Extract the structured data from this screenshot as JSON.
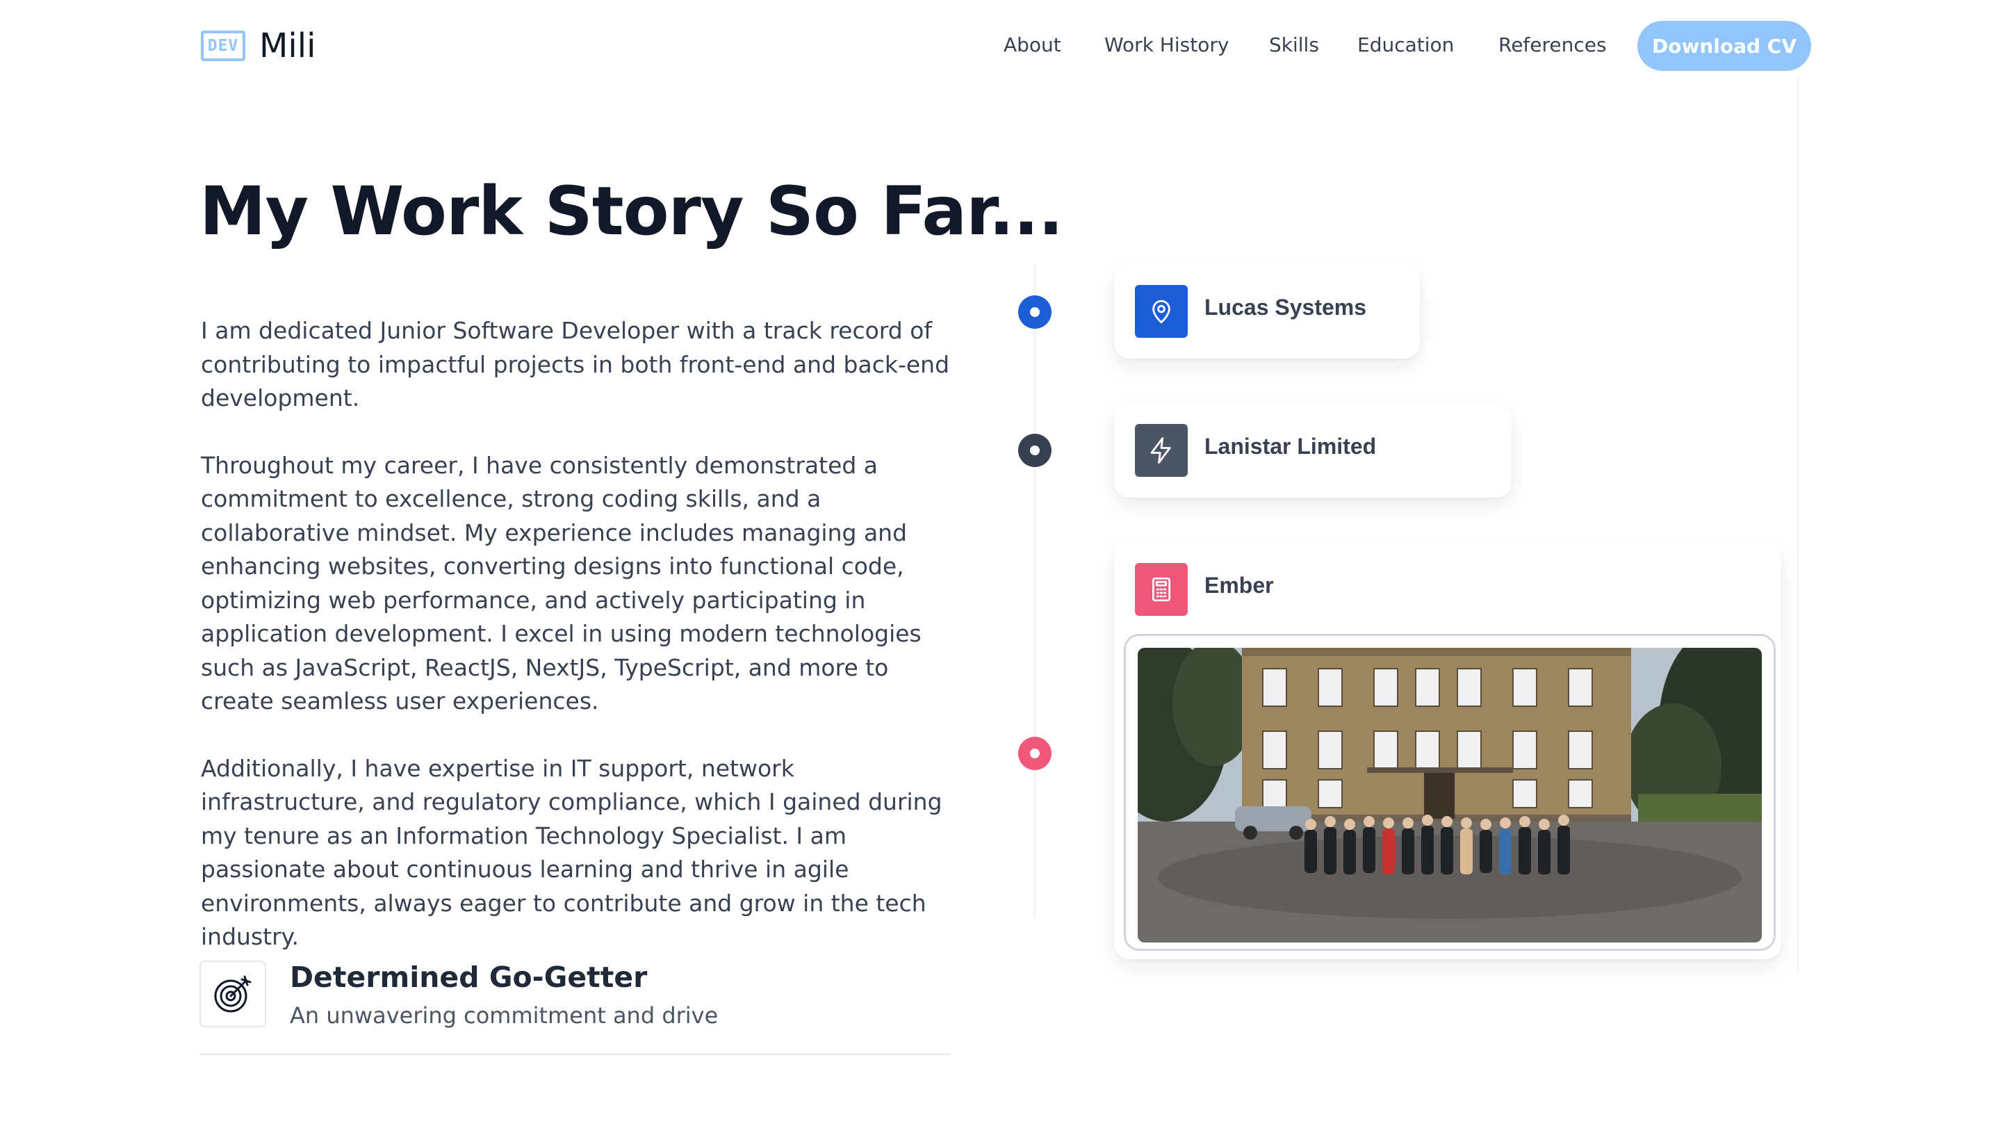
{
  "header": {
    "logo_badge": "DEV",
    "logo_name": "Mili",
    "nav": [
      "About",
      "Work History",
      "Skills",
      "Education",
      "References"
    ],
    "cta": "Download CV"
  },
  "main": {
    "title": "My Work Story So Far...",
    "bio": [
      "I am dedicated Junior Software Developer with a track record of contributing to impactful projects in both front-end and back-end development.",
      "Throughout my career, I have consistently demonstrated a commitment to excellence, strong coding skills, and a collaborative mindset. My experience includes managing and enhancing websites, converting designs into functional code, optimizing web performance, and actively participating in application development. I excel in using modern technologies such as JavaScript, ReactJS, NextJS, TypeScript, and more to create seamless user experiences.",
      "Additionally, I have expertise in IT support, network infrastructure, and regulatory compliance, which I gained during my tenure as an Information Technology Specialist. I am passionate about continuous learning and thrive in agile environments, always eager to contribute and grow in the tech industry."
    ],
    "trait": {
      "title": "Determined Go-Getter",
      "subtitle": "An unwavering commitment and drive",
      "icon": "target-icon"
    }
  },
  "timeline": [
    {
      "company": "Lucas Systems",
      "icon": "map-pin-icon",
      "color": "#1d5ed8"
    },
    {
      "company": "Lanistar Limited",
      "icon": "lightning-icon",
      "color": "#4b5563"
    },
    {
      "company": "Ember",
      "icon": "calculator-icon",
      "color": "#f0587a"
    }
  ],
  "colors": {
    "accent": "#93c5fd",
    "text": "#111827",
    "body_text": "#374151"
  }
}
